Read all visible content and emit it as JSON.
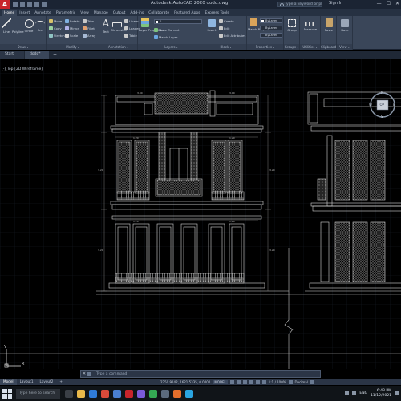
{
  "window": {
    "title": "Autodesk AutoCAD 2020   dodo.dwg",
    "search_placeholder": "Type a keyword or phrase",
    "signin": "Sign In",
    "controls": [
      "—",
      "☐",
      "✕"
    ]
  },
  "ribbon_tabs": [
    "Home",
    "Insert",
    "Annotate",
    "Parametric",
    "View",
    "Manage",
    "Output",
    "Add-ins",
    "Collaborate",
    "Featured Apps",
    "Express Tools"
  ],
  "ribbon": {
    "draw": {
      "label": "Draw ▾",
      "line": "Line",
      "polyline": "Polyline",
      "circle": "Circle",
      "arc": "Arc"
    },
    "modify": {
      "label": "Modify ▾",
      "move": "Move",
      "rotate": "Rotate",
      "trim": "Trim",
      "copy": "Copy",
      "mirror": "Mirror",
      "fillet": "Fillet",
      "stretch": "Stretch",
      "scale": "Scale",
      "array": "Array"
    },
    "annotation": {
      "label": "Annotation ▾",
      "text": "Text",
      "dimension": "Dimension",
      "linear": "Linear",
      "leader": "Leader",
      "table": "Table"
    },
    "layers": {
      "label": "Layers ▾",
      "layer_properties": "Layer Properties",
      "layer_combo": "0",
      "make_current": "Make Current",
      "match_layer": "Match Layer"
    },
    "block": {
      "label": "Block ▾",
      "insert": "Insert",
      "create": "Create",
      "edit": "Edit",
      "edit_attributes": "Edit Attributes"
    },
    "properties": {
      "label": "Properties ▾",
      "match_properties": "Match Properties",
      "color": "ByLayer",
      "linetype": "ByLayer",
      "lineweight": "ByLayer"
    },
    "groups": {
      "label": "Groups ▾",
      "group": "Group"
    },
    "utilities": {
      "label": "Utilities ▾",
      "measure": "Measure"
    },
    "clipboard": {
      "label": "Clipboard",
      "paste": "Paste"
    },
    "view": {
      "label": "View ▾",
      "base": "Base"
    }
  },
  "file_tabs": [
    "Start",
    "dodo*"
  ],
  "canvas": {
    "view_label": "[-][Top][2D Wireframe]",
    "viewcube": {
      "top": "TOP",
      "n": "N",
      "s": "S",
      "e": "E",
      "w": "W"
    },
    "ucs": {
      "x": "X",
      "y": "Y"
    }
  },
  "command": {
    "close": "✕",
    "prompt": "Type a command"
  },
  "layout_tabs": [
    "Model",
    "Layout1",
    "Layout2",
    "+"
  ],
  "status": {
    "coords": "2250.9142, 1621.5335, 0.0000",
    "mode": "MODEL",
    "annotation_scale": "1:1 / 100%",
    "units": "Decimal"
  },
  "taskbar": {
    "search_placeholder": "Type here to search",
    "language": "ENG",
    "clock_time": "6:43 PM",
    "clock_date": "11/12/2021"
  },
  "colors": {
    "drawing_line": "#d6d6d6",
    "grid": "#141a22",
    "ribbon_bg": "#3a4659",
    "accent_red": "#c8242b"
  }
}
